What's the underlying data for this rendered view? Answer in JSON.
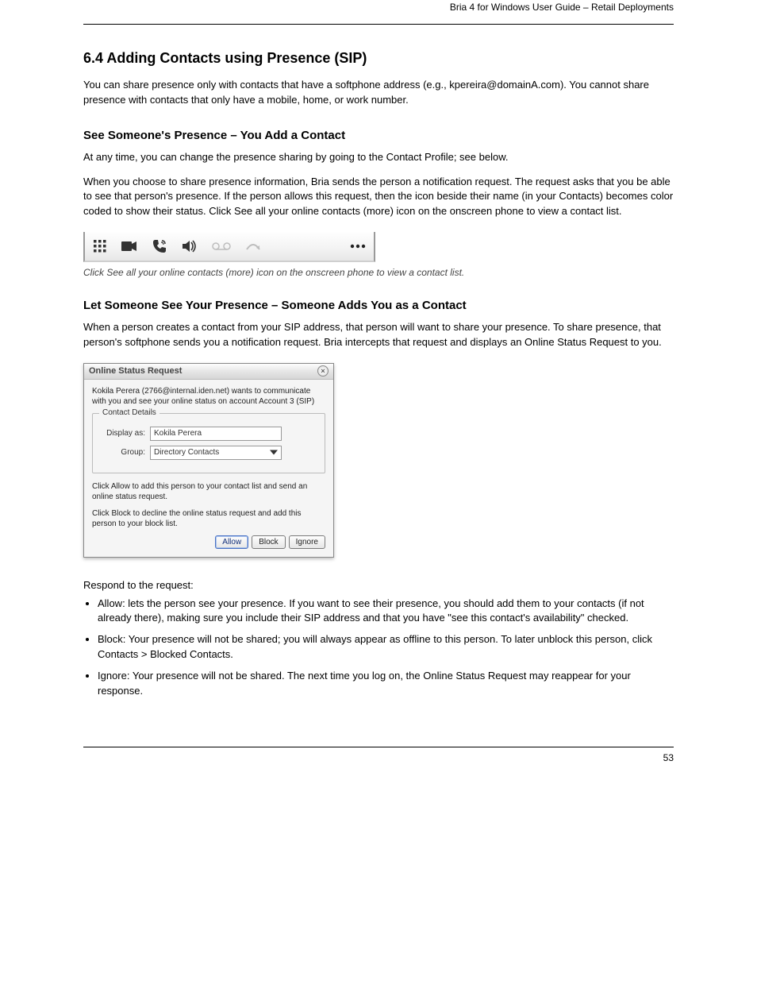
{
  "header": {
    "right": "Bria 4 for Windows User Guide – Retail Deployments"
  },
  "section1": {
    "title": "6.4 Adding Contacts using Presence (SIP)",
    "para1": "You can share presence only with contacts that have a softphone address (e.g., kpereira@domainA.com). You cannot share presence with contacts that only have a mobile, home, or work number.",
    "sub1": "See Someone's Presence – You Add a Contact",
    "para2": "At any time, you can change the presence sharing by going to the Contact Profile; see below.",
    "para3": "When you choose to share presence information, Bria sends the person a notification request. The request asks that you be able to see that person's presence. If the person allows this request, then the icon beside their name (in your Contacts) becomes color coded to show their status. Click See all your online contacts (more) icon on the onscreen phone to view a contact list."
  },
  "toolbar": {
    "icons": [
      "dialpad-icon",
      "video-icon",
      "call-icon",
      "speaker-icon",
      "voicemail-icon",
      "redo-icon",
      "more-icon"
    ],
    "caption": "Click See all your online contacts (more) icon on the onscreen phone to view a contact list."
  },
  "section2": {
    "title": "Let Someone See Your Presence – Someone Adds You as a Contact",
    "para1": "When a person creates a contact from your SIP address, that person will want to share your presence. To share presence, that person's softphone sends you a notification request. Bria intercepts that request and displays an Online Status Request to you."
  },
  "dialog": {
    "title": "Online Status Request",
    "close": "×",
    "message": "Kokila Perera (2766@internal.iden.net)  wants to communicate with you and see your online status on account Account 3 (SIP)",
    "fieldset_legend": "Contact Details",
    "display_as_label": "Display as:",
    "display_as_value": "Kokila Perera",
    "group_label": "Group:",
    "group_value": "Directory Contacts",
    "help1": "Click Allow to add this person to your contact list and send an online status request.",
    "help2": "Click Block to decline the online status request and add this person to your block list.",
    "buttons": {
      "allow": "Allow",
      "block": "Block",
      "ignore": "Ignore"
    }
  },
  "section3": {
    "para1": "Respond to the request:",
    "bullets": [
      "Allow: lets the person see your presence. If you want to see their presence, you should add them to your contacts (if not already there), making sure you include their SIP address and that you have \"see this contact's availability\" checked.",
      "Block: Your presence will not be shared; you will always appear as offline to this person. To later unblock this person, click Contacts > Blocked Contacts.",
      "Ignore: Your presence will not be shared. The next time you log on, the Online Status Request may reappear for your response."
    ]
  },
  "footer": {
    "page": "53"
  }
}
